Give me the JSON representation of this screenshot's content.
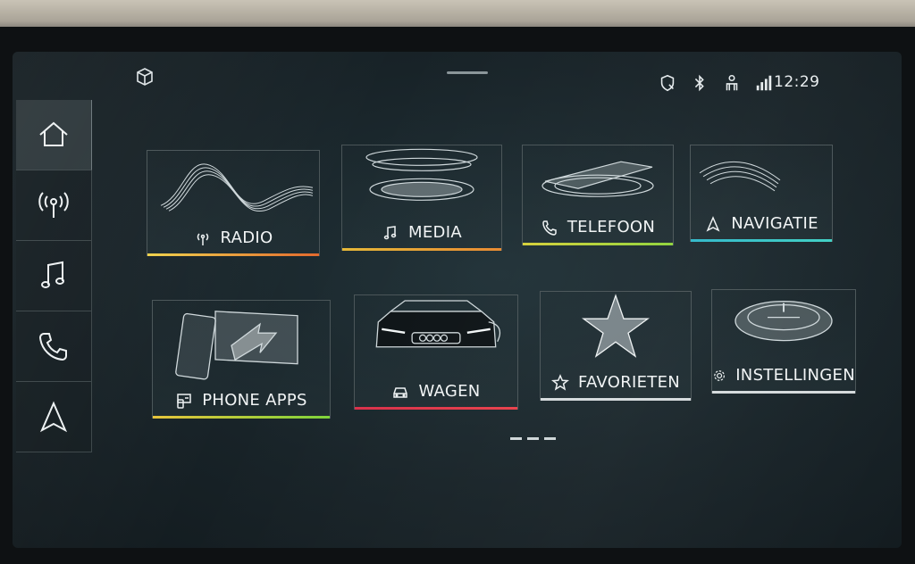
{
  "status": {
    "time": "12:29",
    "icons": [
      "cube-icon",
      "privacy-shield-icon",
      "bluetooth-icon",
      "person-icon",
      "signal-icon"
    ]
  },
  "sidebar": {
    "items": [
      {
        "name": "home",
        "icon": "home-icon",
        "active": true
      },
      {
        "name": "radio",
        "icon": "radio-antenna-icon"
      },
      {
        "name": "media",
        "icon": "music-note-icon"
      },
      {
        "name": "phone",
        "icon": "phone-icon"
      },
      {
        "name": "navigation",
        "icon": "navigation-arrow-icon"
      }
    ]
  },
  "tiles": [
    {
      "label": "RADIO",
      "icon": "radio-antenna-icon",
      "accent": "#e8a23a"
    },
    {
      "label": "MEDIA",
      "icon": "music-note-icon",
      "accent": "#e0b33a"
    },
    {
      "label": "TELEFOON",
      "icon": "phone-icon",
      "accent": "#b9d23a"
    },
    {
      "label": "NAVIGATIE",
      "icon": "navigation-arrow-icon",
      "accent": "#2fb7c9"
    },
    {
      "label": "PHONE APPS",
      "icon": "phone-apps-icon",
      "accent": "#9bd43a"
    },
    {
      "label": "WAGEN",
      "icon": "car-icon",
      "accent": "#e0334a"
    },
    {
      "label": "FAVORIETEN",
      "icon": "star-icon",
      "accent": "#d5dadc"
    },
    {
      "label": "INSTELLINGEN",
      "icon": "gear-icon",
      "accent": "#d5dadc"
    }
  ],
  "pager": {
    "pages": 3
  }
}
